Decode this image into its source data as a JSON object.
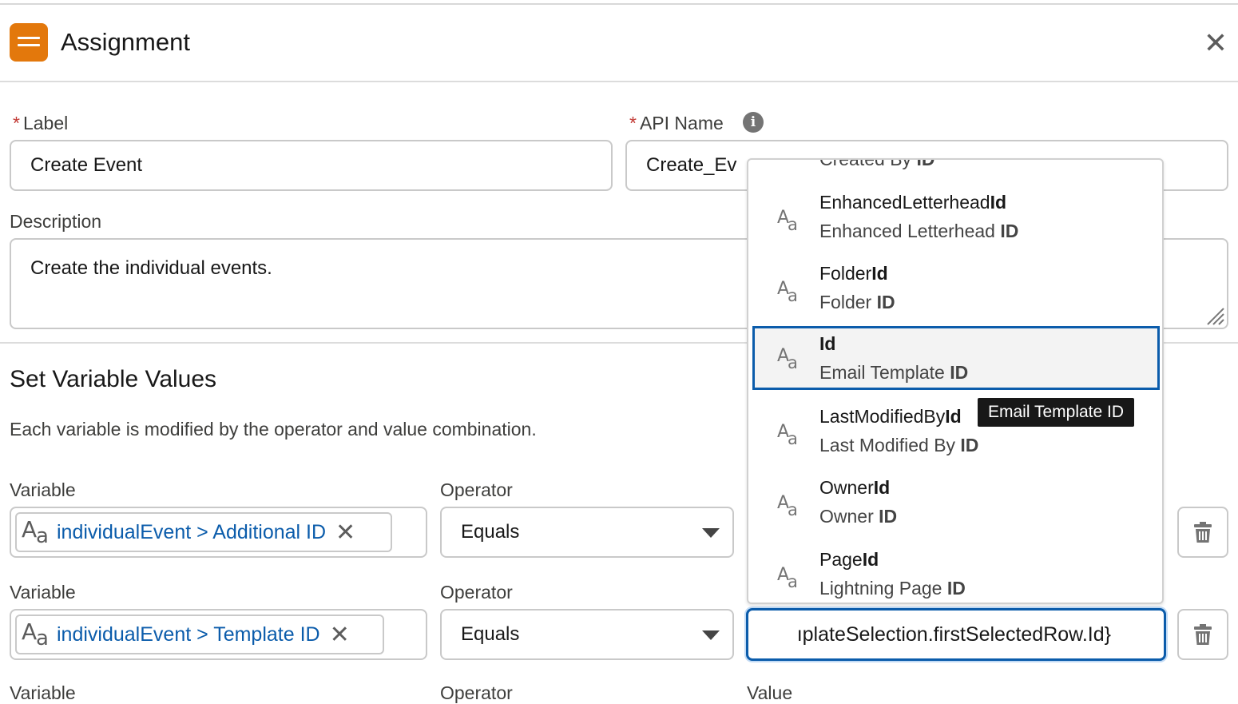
{
  "header": {
    "title": "Assignment",
    "close_glyph": "✕",
    "icon": "assignment-icon"
  },
  "form": {
    "label_field": {
      "label": "Label",
      "value": "Create Event"
    },
    "api_name_field": {
      "label": "API Name",
      "value": "Create_Ev"
    },
    "description_field": {
      "label": "Description",
      "value": "Create the individual events."
    },
    "required_marker": "*"
  },
  "section": {
    "title": "Set Variable Values",
    "description": "Each variable is modified by the operator and value combination."
  },
  "rows": [
    {
      "variable_label": "Variable",
      "operator_label": "Operator",
      "variable": "individualEvent > Additional ID",
      "operator": "Equals"
    },
    {
      "variable_label": "Variable",
      "operator_label": "Operator",
      "variable": "individualEvent > Template ID",
      "operator": "Equals",
      "value": "ıplateSelection.firstSelectedRow.Id}"
    },
    {
      "variable_label": "Variable",
      "operator_label": "Operator",
      "value_label": "Value"
    }
  ],
  "dropdown": {
    "partial_top": {
      "line1": "Created By",
      "line1_bold": "ID"
    },
    "items": [
      {
        "name_plain": "EnhancedLetterhead",
        "name_bold": "Id",
        "desc_plain": "Enhanced Letterhead ",
        "desc_bold": "ID"
      },
      {
        "name_plain": "Folder",
        "name_bold": "Id",
        "desc_plain": "Folder ",
        "desc_bold": "ID"
      },
      {
        "name_plain": "",
        "name_bold": "Id",
        "desc_plain": "Email Template ",
        "desc_bold": "ID"
      },
      {
        "name_plain": "LastModifiedBy",
        "name_bold": "Id",
        "desc_plain": "Last Modified By ",
        "desc_bold": "ID"
      },
      {
        "name_plain": "Owner",
        "name_bold": "Id",
        "desc_plain": "Owner ",
        "desc_bold": "ID"
      },
      {
        "name_plain": "Page",
        "name_bold": "Id",
        "desc_plain": "Lightning Page ",
        "desc_bold": "ID"
      }
    ],
    "selected_index": 2,
    "tooltip": "Email Template ID"
  },
  "colors": {
    "accent": "#0b5cab",
    "header_icon": "#e3780c",
    "required": "#c23934"
  }
}
